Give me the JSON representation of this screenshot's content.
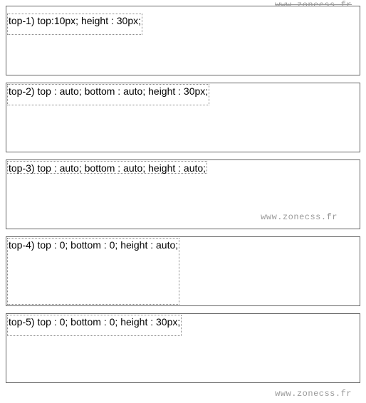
{
  "watermark": {
    "top": "www.zonecss.fr",
    "mid": "www.zonecss.fr",
    "bot": "www.zonecss.fr"
  },
  "boxes": [
    {
      "label": "top-1) top:10px; height : 30px;"
    },
    {
      "label": "top-2) top : auto; bottom : auto; height : 30px;"
    },
    {
      "label": "top-3) top : auto; bottom : auto; height : auto;"
    },
    {
      "label": "top-4) top : 0; bottom : 0; height : auto;"
    },
    {
      "label": "top-5) top : 0; bottom : 0; height : 30px;"
    }
  ]
}
